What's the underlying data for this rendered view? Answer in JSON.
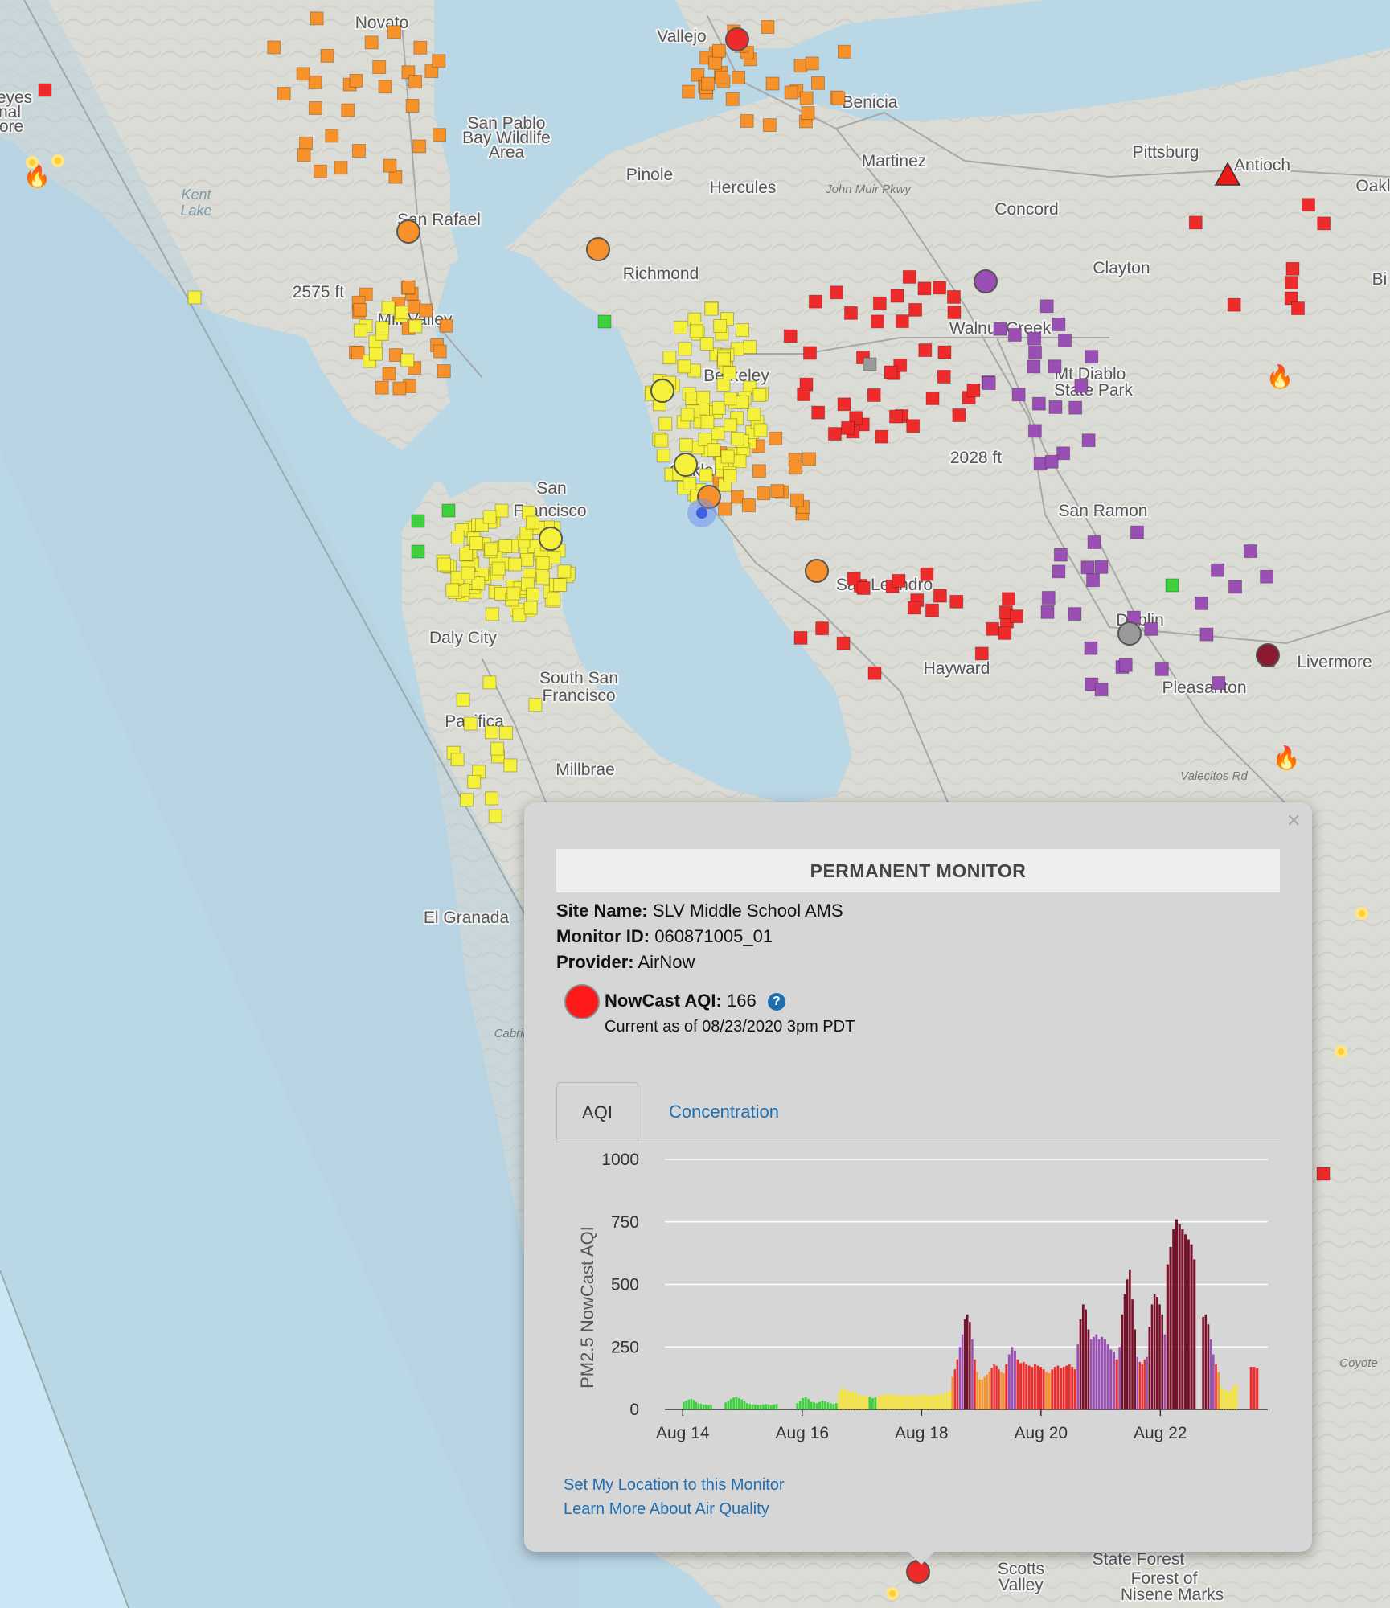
{
  "map": {
    "places": [
      {
        "name": "Novato",
        "x": 475,
        "y": 35
      },
      {
        "name": "Vallejo",
        "x": 848,
        "y": 52
      },
      {
        "name": "San Pablo",
        "x": 630,
        "y": 160
      },
      {
        "name": "Bay Wildlife",
        "x": 630,
        "y": 178
      },
      {
        "name": "Area",
        "x": 630,
        "y": 196
      },
      {
        "name": "Benicia",
        "x": 1082,
        "y": 134
      },
      {
        "name": "Martinez",
        "x": 1112,
        "y": 207
      },
      {
        "name": "Pittsburg",
        "x": 1450,
        "y": 196
      },
      {
        "name": "Antioch",
        "x": 1570,
        "y": 212
      },
      {
        "name": "Pinole",
        "x": 808,
        "y": 224
      },
      {
        "name": "Hercules",
        "x": 924,
        "y": 240
      },
      {
        "name": "Concord",
        "x": 1277,
        "y": 267
      },
      {
        "name": "San Rafael",
        "x": 546,
        "y": 280
      },
      {
        "name": "Richmond",
        "x": 822,
        "y": 347
      },
      {
        "name": "Clayton",
        "x": 1395,
        "y": 340
      },
      {
        "name": "2575 ft",
        "x": 396,
        "y": 370
      },
      {
        "name": "Mill Valley",
        "x": 516,
        "y": 404
      },
      {
        "name": "Walnut Creek",
        "x": 1244,
        "y": 415
      },
      {
        "name": "Mt Diablo",
        "x": 1356,
        "y": 472
      },
      {
        "name": "State Park",
        "x": 1360,
        "y": 492
      },
      {
        "name": "Berkeley",
        "x": 916,
        "y": 474
      },
      {
        "name": "2028 ft",
        "x": 1214,
        "y": 576
      },
      {
        "name": "San",
        "x": 686,
        "y": 614
      },
      {
        "name": "Francisco",
        "x": 684,
        "y": 642
      },
      {
        "name": "Oakland",
        "x": 872,
        "y": 592
      },
      {
        "name": "San Ramon",
        "x": 1372,
        "y": 642
      },
      {
        "name": "San Leandro",
        "x": 1100,
        "y": 734
      },
      {
        "name": "Dublin",
        "x": 1418,
        "y": 778
      },
      {
        "name": "Livermore",
        "x": 1660,
        "y": 830
      },
      {
        "name": "Daly City",
        "x": 576,
        "y": 800
      },
      {
        "name": "Hayward",
        "x": 1190,
        "y": 838
      },
      {
        "name": "South San",
        "x": 720,
        "y": 850
      },
      {
        "name": "Francisco",
        "x": 720,
        "y": 872
      },
      {
        "name": "Pleasanton",
        "x": 1498,
        "y": 862
      },
      {
        "name": "Pacifica",
        "x": 590,
        "y": 904
      },
      {
        "name": "Millbrae",
        "x": 728,
        "y": 964
      },
      {
        "name": "El Granada",
        "x": 580,
        "y": 1148
      },
      {
        "name": "Scotts",
        "x": 1270,
        "y": 1958
      },
      {
        "name": "Valley",
        "x": 1270,
        "y": 1978
      },
      {
        "name": "State Forest",
        "x": 1416,
        "y": 1946
      },
      {
        "name": "Forest of",
        "x": 1448,
        "y": 1970
      },
      {
        "name": "Nisene Marks",
        "x": 1458,
        "y": 1990
      },
      {
        "name": "Oakl",
        "x": 1708,
        "y": 238
      },
      {
        "name": "Bi",
        "x": 1716,
        "y": 354
      },
      {
        "name": "eyes",
        "x": 18,
        "y": 128
      },
      {
        "name": "nal",
        "x": 12,
        "y": 146
      },
      {
        "name": "ore",
        "x": 14,
        "y": 164
      }
    ],
    "water_labels": [
      {
        "name": "Kent",
        "x": 244,
        "y": 248
      },
      {
        "name": "Lake",
        "x": 244,
        "y": 268
      }
    ],
    "road_labels": [
      {
        "name": "John Muir Pkwy",
        "x": 1080,
        "y": 240
      },
      {
        "name": "Valecitos Rd",
        "x": 1510,
        "y": 970
      },
      {
        "name": "Cabrillo",
        "x": 640,
        "y": 1290
      },
      {
        "name": "Coyote",
        "x": 1690,
        "y": 1700
      }
    ],
    "sensor_colors": {
      "good": "#3dd13d",
      "moderate": "#f5f03a",
      "usg": "#f7922b",
      "unhealthy": "#ee2a2a",
      "very_unhealthy": "#9a4fb5",
      "hazardous": "#8a1a30",
      "nodata": "#9a9a9a"
    }
  },
  "popup": {
    "close_label": "×",
    "header": "PERMANENT MONITOR",
    "site_name_label": "Site Name:",
    "site_name": "SLV Middle School AMS",
    "monitor_id_label": "Monitor ID:",
    "monitor_id": "060871005_01",
    "provider_label": "Provider:",
    "provider": "AirNow",
    "nowcast_label": "NowCast AQI:",
    "nowcast_value": "166",
    "help_icon": "?",
    "current_as_of": "Current as of 08/23/2020 3pm PDT",
    "aqi_color": "#ff1a1a",
    "tabs": [
      {
        "label": "AQI",
        "active": true
      },
      {
        "label": "Concentration",
        "active": false
      }
    ],
    "links": {
      "set_location": "Set My Location to this Monitor",
      "learn_more": "Learn More About Air Quality"
    }
  },
  "chart_data": {
    "type": "bar",
    "ylabel": "PM2.5 NowCast AQI",
    "ylim": [
      0,
      1000
    ],
    "yticks": [
      0,
      250,
      500,
      750,
      1000
    ],
    "xticks": [
      "Aug 14",
      "Aug 16",
      "Aug 18",
      "Aug 20",
      "Aug 22"
    ],
    "xtick_days": [
      14,
      16,
      18,
      20,
      22
    ],
    "xlim_days": [
      13.7,
      23.8
    ],
    "grid": true,
    "color_bands": [
      {
        "max": 50,
        "color": "#3dd13d"
      },
      {
        "max": 100,
        "color": "#f5e33a"
      },
      {
        "max": 150,
        "color": "#f7922b"
      },
      {
        "max": 200,
        "color": "#ee2a2a"
      },
      {
        "max": 300,
        "color": "#9a4fb5"
      },
      {
        "max": 1000,
        "color": "#7a0f2a"
      }
    ],
    "segments": [
      {
        "start": 14.0,
        "end": 14.5,
        "values": [
          30,
          35,
          40,
          42,
          38,
          30,
          25,
          22,
          20,
          20,
          18,
          18
        ]
      },
      {
        "start": 14.7,
        "end": 15.6,
        "values": [
          28,
          35,
          42,
          48,
          50,
          45,
          40,
          32,
          25,
          22,
          20,
          20,
          18,
          18,
          20,
          22,
          20,
          18,
          20,
          22
        ]
      },
      {
        "start": 15.9,
        "end": 16.6,
        "values": [
          25,
          35,
          45,
          50,
          42,
          30,
          28,
          25,
          30,
          35,
          32,
          28,
          25,
          22,
          25
        ]
      },
      {
        "start": 16.6,
        "end": 17.3,
        "values": [
          70,
          85,
          80,
          75,
          70,
          72,
          68,
          60,
          55,
          55,
          52,
          50,
          45,
          48,
          52
        ]
      },
      {
        "start": 17.3,
        "end": 18.5,
        "values": [
          55,
          60,
          58,
          62,
          60,
          58,
          56,
          55,
          56,
          58,
          55,
          54,
          56,
          55,
          58,
          60,
          58,
          55,
          56,
          58,
          60,
          62,
          65,
          70,
          75
        ]
      },
      {
        "start": 18.5,
        "end": 19.0,
        "values": [
          130,
          160,
          200,
          250,
          300,
          360,
          380,
          350,
          280,
          200,
          150,
          120
        ]
      },
      {
        "start": 19.0,
        "end": 19.4,
        "values": [
          120,
          130,
          140,
          150,
          165,
          180,
          175,
          160,
          150,
          145
        ]
      },
      {
        "start": 19.4,
        "end": 20.6,
        "values": [
          180,
          220,
          250,
          235,
          200,
          185,
          190,
          180,
          175,
          170,
          180,
          175,
          170,
          160,
          150,
          145,
          160,
          170,
          175,
          165,
          170,
          175,
          180,
          170,
          160
        ]
      },
      {
        "start": 20.6,
        "end": 21.0,
        "values": [
          260,
          360,
          420,
          400,
          320,
          280,
          290,
          300,
          280
        ]
      },
      {
        "start": 21.0,
        "end": 21.3,
        "values": [
          290,
          280,
          260,
          240,
          230,
          200
        ]
      },
      {
        "start": 21.3,
        "end": 21.6,
        "values": [
          250,
          380,
          460,
          520,
          560,
          440,
          320
        ]
      },
      {
        "start": 21.6,
        "end": 21.8,
        "values": [
          210,
          190,
          180,
          200,
          210
        ]
      },
      {
        "start": 21.8,
        "end": 22.1,
        "values": [
          330,
          420,
          460,
          450,
          420,
          380,
          300
        ]
      },
      {
        "start": 22.1,
        "end": 22.6,
        "values": [
          580,
          650,
          720,
          760,
          740,
          720,
          700,
          680,
          660,
          600
        ]
      },
      {
        "start": 22.7,
        "end": 23.0,
        "values": [
          370,
          380,
          340,
          280,
          220,
          180,
          150
        ]
      },
      {
        "start": 23.0,
        "end": 23.3,
        "values": [
          90,
          80,
          75,
          70,
          80,
          95,
          100
        ]
      },
      {
        "start": 23.5,
        "end": 23.65,
        "values": [
          170,
          170,
          165
        ]
      }
    ]
  }
}
